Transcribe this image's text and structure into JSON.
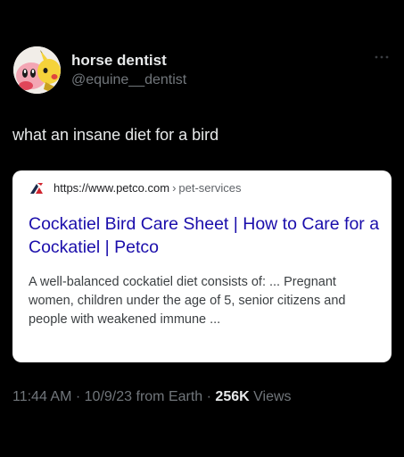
{
  "user": {
    "display_name": "horse dentist",
    "handle": "@equine__dentist"
  },
  "tweet": {
    "text": "what an insane diet for a bird"
  },
  "card": {
    "url_base": "https://www.petco.com",
    "url_separator": "›",
    "url_path": "pet-services",
    "title": "Cockatiel Bird Care Sheet | How to Care for a Cockatiel | Petco",
    "snippet": "A well-balanced cockatiel diet consists of: ... Pregnant women, children under the age of 5, senior citizens and people with weakened immune ..."
  },
  "meta": {
    "time": "11:44 AM",
    "dot1": "·",
    "date": "10/9/23",
    "source": "from Earth",
    "dot2": "·",
    "views_count": "256K",
    "views_label": "Views"
  },
  "icons": {
    "more": "more-horizontal-icon",
    "favicon": "petco-favicon-icon",
    "avatar": "pikachu-kirby-avatar"
  },
  "colors": {
    "background": "#000000",
    "primary_text": "#e7e9ea",
    "secondary_text": "#71767b",
    "card_background": "#ffffff",
    "link_title": "#1a0dab",
    "snippet_text": "#3c4043",
    "favicon_red": "#d0252f",
    "favicon_navy": "#1b2a4a"
  }
}
